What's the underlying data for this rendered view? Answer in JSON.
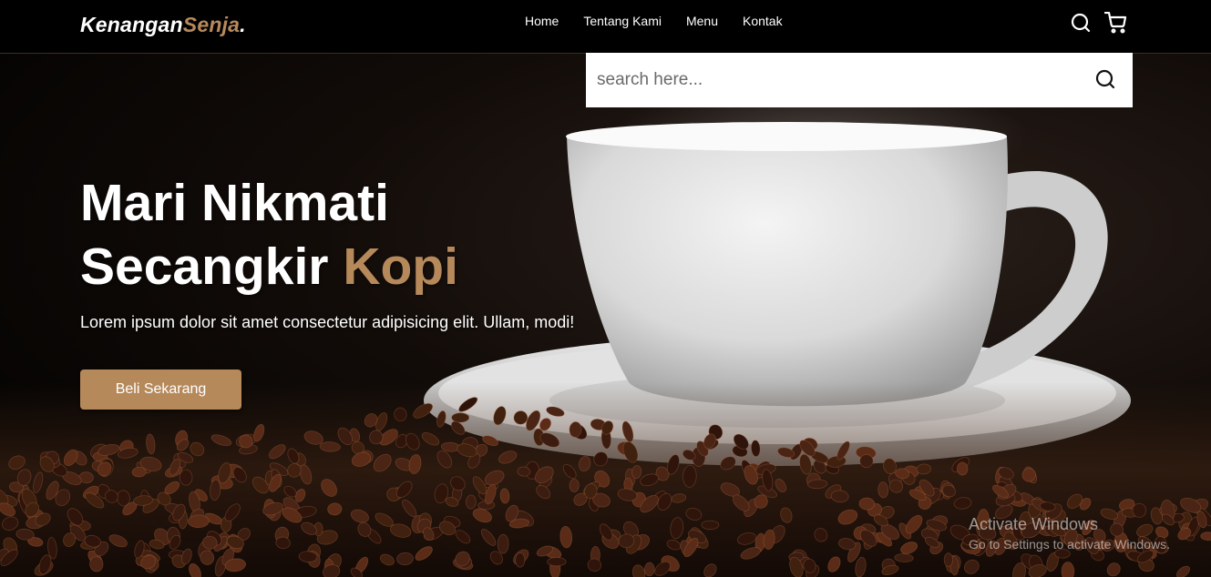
{
  "brand": {
    "name_part1": "Kenangan",
    "name_part2": "Senja",
    "name_dot": "."
  },
  "nav": {
    "items": [
      {
        "label": "Home"
      },
      {
        "label": "Tentang Kami"
      },
      {
        "label": "Menu"
      },
      {
        "label": "Kontak"
      }
    ]
  },
  "header_icons": [
    "search-icon",
    "cart-icon"
  ],
  "search": {
    "placeholder": "search here...",
    "value": "",
    "icon": "search-icon"
  },
  "hero": {
    "title_line1": "Mari Nikmati",
    "title_line2_plain": "Secangkir ",
    "title_line2_accent": "Kopi",
    "description": "Lorem ipsum dolor sit amet consectetur adipisicing elit. Ullam, modi!",
    "cta_label": "Beli Sekarang"
  },
  "watermark": {
    "line1": "Activate Windows",
    "line2": "Go to Settings to activate Windows."
  },
  "colors": {
    "accent": "#b6895b",
    "header_bg": "#000000",
    "text": "#ffffff"
  }
}
